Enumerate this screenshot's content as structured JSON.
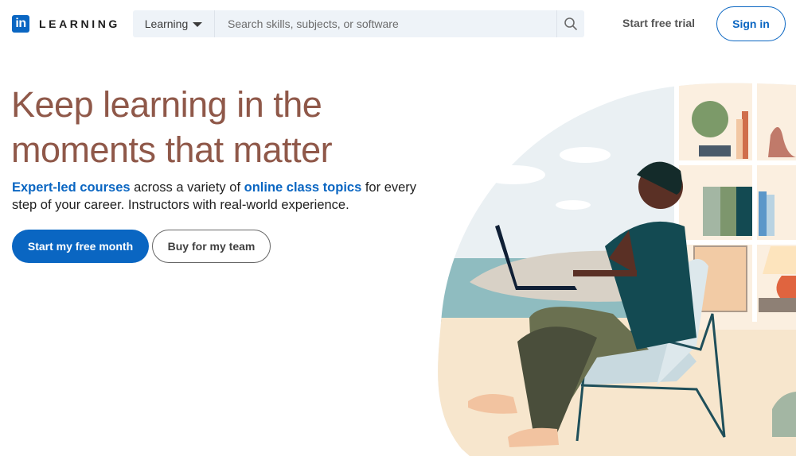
{
  "header": {
    "logo_mark": "in",
    "logo_text": "LEARNING",
    "search_scope": "Learning",
    "search_placeholder": "Search skills, subjects, or software",
    "search_value": "",
    "start_trial_label": "Start free trial",
    "sign_in_label": "Sign in"
  },
  "hero": {
    "title_line1": "Keep learning in the",
    "title_line2": "moments that matter",
    "subtitle": {
      "link1": "Expert-led courses",
      "text1": " across a variety of ",
      "link2": "online class topics",
      "text2": " for every step of your career. Instructors with real-world experience."
    },
    "primary_cta": "Start my free month",
    "secondary_cta": "Buy for my team"
  },
  "illustration": {
    "description": "Person sitting in chair working on laptop in front of bookshelf"
  },
  "colors": {
    "brand": "#0a66c2",
    "title": "#8f5849"
  }
}
